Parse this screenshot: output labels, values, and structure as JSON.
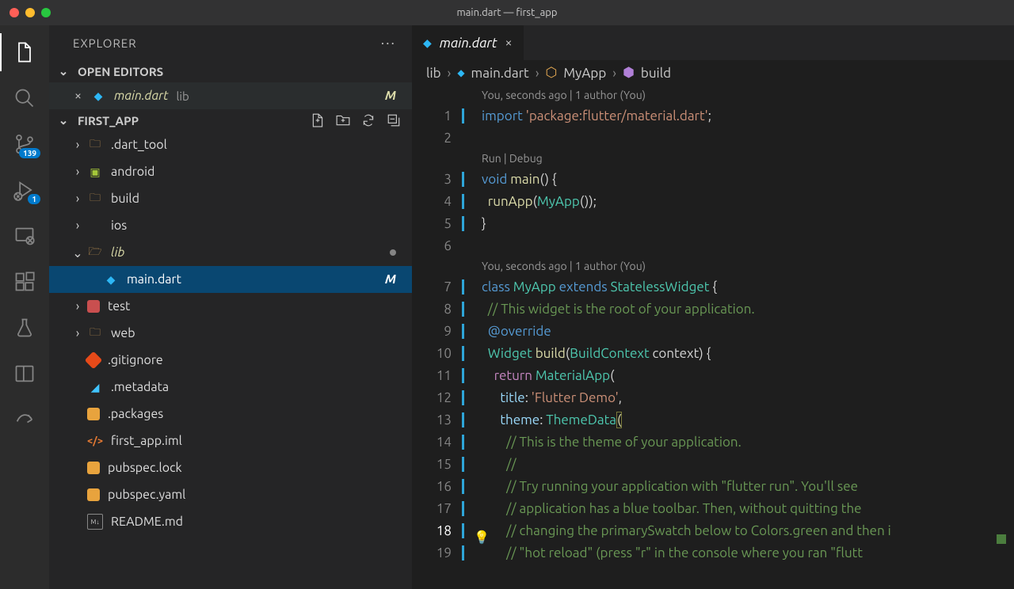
{
  "window_title": "main.dart — first_app",
  "explorer": {
    "title": "EXPLORER"
  },
  "open_editors": {
    "label": "OPEN EDITORS",
    "file": "main.dart",
    "folder": "lib",
    "status": "M"
  },
  "project": {
    "name": "FIRST_APP"
  },
  "tree": {
    "dart_tool": ".dart_tool",
    "android": "android",
    "build": "build",
    "ios": "ios",
    "lib": "lib",
    "main_dart": "main.dart",
    "main_status": "M",
    "test": "test",
    "web": "web",
    "gitignore": ".gitignore",
    "metadata": ".metadata",
    "packages": ".packages",
    "iml": "first_app.iml",
    "pubspec_lock": "pubspec.lock",
    "pubspec_yaml": "pubspec.yaml",
    "readme": "README.md"
  },
  "badges": {
    "scm": "139",
    "debug": "1"
  },
  "tab": {
    "name": "main.dart"
  },
  "breadcrumb": {
    "lib": "lib",
    "file": "main.dart",
    "class": "MyApp",
    "method": "build"
  },
  "lens1": "You, seconds ago | 1 author (You)",
  "lens2": "Run | Debug",
  "lens3": "You, seconds ago | 1 author (You)",
  "code": {
    "l1a": "import",
    "l1b": "'package:flutter/material.dart'",
    "l1c": ";",
    "l3a": "void",
    "l3b": "main",
    "l3c": "() {",
    "l4a": "runApp",
    "l4b": "(",
    "l4c": "MyApp",
    "l4d": "());",
    "l5": "}",
    "l7a": "class",
    "l7b": "MyApp",
    "l7c": "extends",
    "l7d": "StatelessWidget",
    "l7e": " {",
    "l8": "// This widget is the root of your application.",
    "l9": "@override",
    "l10a": "Widget",
    "l10b": "build",
    "l10c": "(",
    "l10d": "BuildContext",
    "l10e": " context) {",
    "l11a": "return",
    "l11b": "MaterialApp",
    "l11c": "(",
    "l12a": "title",
    "l12b": ": ",
    "l12c": "'Flutter Demo'",
    "l12d": ",",
    "l13a": "theme",
    "l13b": ": ",
    "l13c": "ThemeData",
    "l13d": "(",
    "l14": "// This is the theme of your application.",
    "l15": "//",
    "l16": "// Try running your application with \"flutter run\". You'll see",
    "l17": "// application has a blue toolbar. Then, without quitting the",
    "l18": "// changing the primarySwatch below to Colors.green and then i",
    "l19": "// \"hot reload\" (press \"r\" in the console where you ran \"flutt"
  }
}
